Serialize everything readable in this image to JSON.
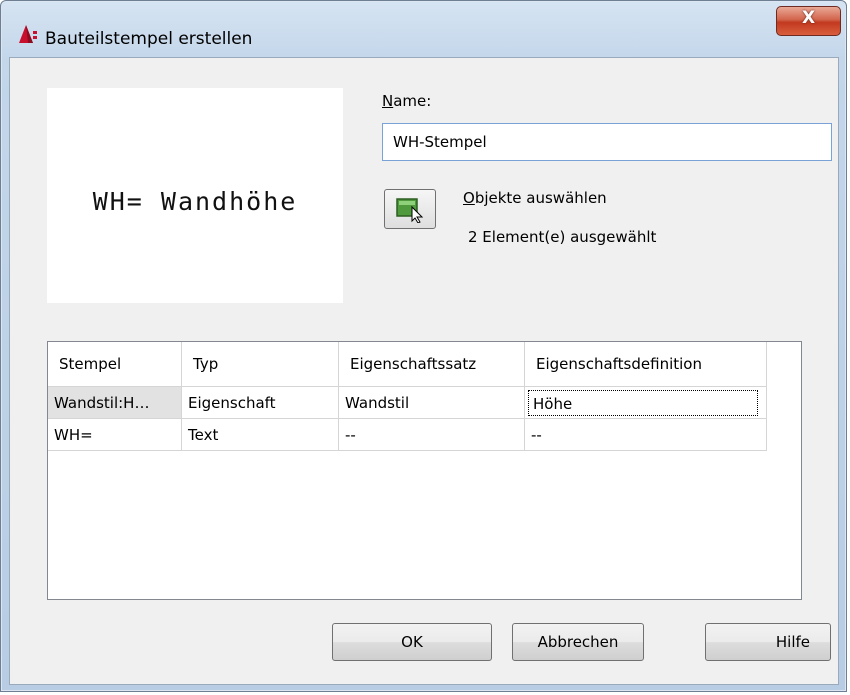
{
  "window": {
    "title": "Bauteilstempel erstellen",
    "close_label": "X"
  },
  "preview": {
    "text": "WH= Wandhöhe"
  },
  "name": {
    "label_mnemonic": "N",
    "label_rest": "ame:",
    "value": "WH-Stempel"
  },
  "select_objects": {
    "label_mnemonic": "O",
    "label_rest": "bjekte auswählen",
    "count_text": "2 Element(e) ausgewählt"
  },
  "grid": {
    "columns": [
      "Stempel",
      "Typ",
      "Eigenschaftssatz",
      "Eigenschaftsdefinition"
    ],
    "rows": [
      [
        "Wandstil:H…",
        "Eigenschaft",
        "Wandstil",
        "Höhe"
      ],
      [
        "WH=",
        "Text",
        "--",
        "--"
      ]
    ]
  },
  "buttons": {
    "ok": "OK",
    "cancel": "Abbrechen",
    "help": "Hilfe"
  },
  "colors": {
    "frame": "#c3d6ea",
    "client": "#f0f0f0",
    "close": "#c2391f",
    "input_border": "#7aa2d6"
  }
}
